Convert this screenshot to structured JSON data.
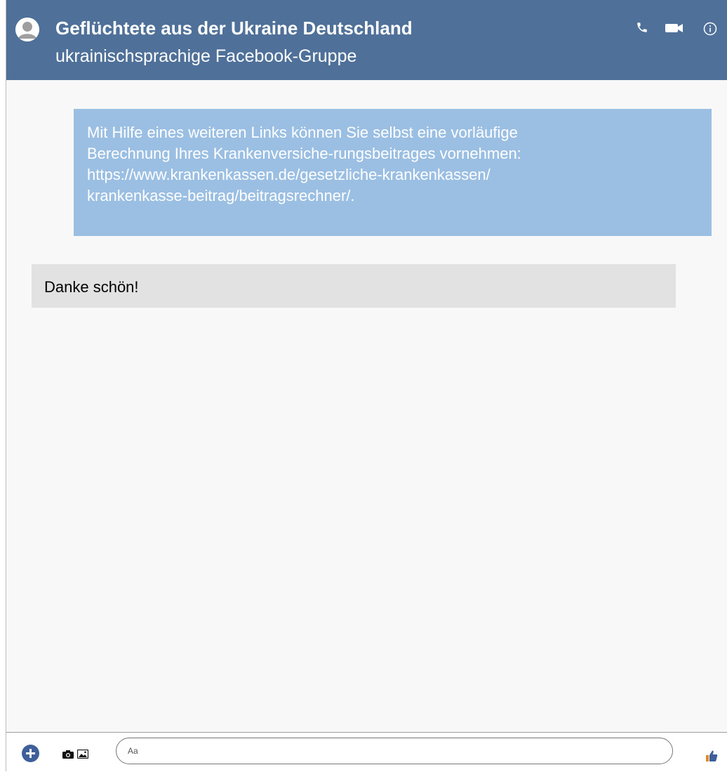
{
  "header": {
    "title": "Geflüchtete aus der Ukraine Deutschland",
    "subtitle": "ukrainischsprachige Facebook-Gruppe",
    "icons": [
      "avatar-icon",
      "phone-icon",
      "video-camera-icon",
      "info-icon"
    ]
  },
  "messages": [
    {
      "direction": "outgoing",
      "text": "Mit Hilfe eines weiteren Links können Sie selbst eine vorläufige\nBerechnung Ihres Krankenversiche-rungsbeitrages vornehmen:\n https://www.krankenkassen.de/gesetzliche-krankenkassen/\nkrankenkasse-beitrag/beitragsrechner/."
    },
    {
      "direction": "incoming",
      "text": "Danke schön!"
    }
  ],
  "composer": {
    "placeholder": "Aa",
    "value": "",
    "icons": [
      "plus-icon",
      "camera-icon",
      "image-icon",
      "thumbs-up-icon"
    ]
  },
  "colors": {
    "header_bg": "#4f7199",
    "outgoing_bubble": "#9bbfe3",
    "incoming_bubble": "#e2e2e2",
    "accent": "#3f5f9a"
  }
}
